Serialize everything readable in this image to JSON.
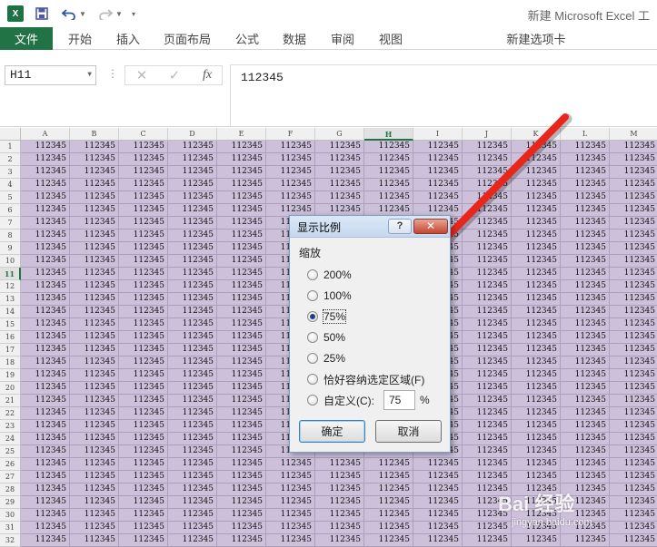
{
  "app": {
    "logo_text": "X",
    "window_title": "新建 Microsoft Excel 工"
  },
  "ribbon": {
    "tabs": [
      "文件",
      "开始",
      "插入",
      "页面布局",
      "公式",
      "数据",
      "审阅",
      "视图",
      "新建选项卡"
    ]
  },
  "formula_bar": {
    "name_box": "H11",
    "fx_label": "fx",
    "value": "112345"
  },
  "grid": {
    "columns": [
      "A",
      "B",
      "C",
      "D",
      "E",
      "F",
      "G",
      "H",
      "I",
      "J",
      "K",
      "L",
      "M"
    ],
    "selected_column": "H",
    "row_count": 32,
    "selected_row": 11,
    "cell_value": "112345",
    "fill_color": "#ccc0da"
  },
  "dialog": {
    "title": "显示比例",
    "help_label": "?",
    "close_label": "✕",
    "group_label": "缩放",
    "options": [
      "200%",
      "100%",
      "75%",
      "50%",
      "25%",
      "恰好容纳选定区域(F)",
      "自定义(C):"
    ],
    "selected_option": "75%",
    "custom_value": "75",
    "percent_sign": "%",
    "ok_label": "确定",
    "cancel_label": "取消"
  },
  "annotation": {
    "arrow_color": "#e8261c"
  },
  "watermark": {
    "text": "Bai 经验",
    "sub": "jingyan.baidu.com"
  }
}
